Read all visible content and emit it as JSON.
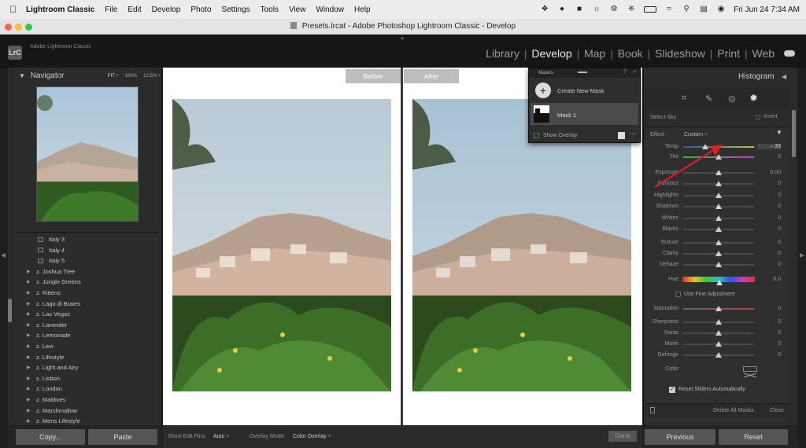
{
  "menubar": {
    "app": "Lightroom Classic",
    "items": [
      "File",
      "Edit",
      "Develop",
      "Photo",
      "Settings",
      "Tools",
      "View",
      "Window",
      "Help"
    ],
    "datetime": "Fri Jun 24  7:34 AM"
  },
  "window": {
    "title": "Presets.lrcat - Adobe Photoshop Lightroom Classic - Develop"
  },
  "identity": {
    "logo": "LrC",
    "line1": "Adobe Lightroom Classic"
  },
  "modules": [
    "Library",
    "Develop",
    "Map",
    "Book",
    "Slideshow",
    "Print",
    "Web"
  ],
  "active_module": "Develop",
  "navigator": {
    "title": "Navigator",
    "zoom": [
      "FIT ÷",
      "100%",
      "12.5% ÷"
    ]
  },
  "presets": [
    {
      "label": "Italy 3",
      "kind": "preset"
    },
    {
      "label": "Italy 4",
      "kind": "preset"
    },
    {
      "label": "Italy 5",
      "kind": "preset"
    },
    {
      "label": "z. Joshua Tree",
      "kind": "group"
    },
    {
      "label": "z. Jungle Greens",
      "kind": "group"
    },
    {
      "label": "z. Kittens",
      "kind": "group"
    },
    {
      "label": "z. Lago di Braies",
      "kind": "group"
    },
    {
      "label": "z. Las Vegas",
      "kind": "group"
    },
    {
      "label": "z. Lavender",
      "kind": "group"
    },
    {
      "label": "z. Lemonade",
      "kind": "group"
    },
    {
      "label": "z. Levi",
      "kind": "group"
    },
    {
      "label": "z. Lifestyle",
      "kind": "group"
    },
    {
      "label": "z. Light and Airy",
      "kind": "group"
    },
    {
      "label": "z. Lisbon",
      "kind": "group"
    },
    {
      "label": "z. London",
      "kind": "group"
    },
    {
      "label": "z. Maldives",
      "kind": "group"
    },
    {
      "label": "z. Marshmallow",
      "kind": "group"
    },
    {
      "label": "z. Mens Lifestyle",
      "kind": "group"
    }
  ],
  "left_buttons": {
    "copy": "Copy...",
    "paste": "Paste"
  },
  "compare": {
    "before": "Before",
    "after": "After"
  },
  "toolbar": {
    "edit_pins_label": "Show Edit Pins:",
    "edit_pins_value": "Auto ÷",
    "overlay_label": "Overlay Mode:",
    "overlay_value": "Color Overlay ÷",
    "done": "Done"
  },
  "masks": {
    "title": "Masks",
    "create": "Create New Mask",
    "mask1": "Mask 1",
    "show_overlay": "Show Overlay"
  },
  "right": {
    "histogram": "Histogram",
    "select_sky": "Select Sky",
    "invert": "Invert",
    "effect_label": "Effect :",
    "effect_value": "Custom ÷",
    "temp_label": "Temp",
    "temp_value": "– 33",
    "temp_pos": 0.31,
    "tint_label": "Tint",
    "tint_value": "0",
    "basic": [
      {
        "label": "Exposure",
        "value": "0.00"
      },
      {
        "label": "Contrast",
        "value": "0"
      },
      {
        "label": "Highlights",
        "value": "0"
      },
      {
        "label": "Shadows",
        "value": "0"
      },
      {
        "label": "Whites",
        "value": "0"
      },
      {
        "label": "Blacks",
        "value": "0"
      }
    ],
    "presence": [
      {
        "label": "Texture",
        "value": "0"
      },
      {
        "label": "Clarity",
        "value": "0"
      },
      {
        "label": "Dehaze",
        "value": "0"
      }
    ],
    "hue_label": "Hue",
    "hue_value": "0.0",
    "fine_adjust": "Use Fine Adjustment",
    "saturation_label": "Saturation",
    "saturation_value": "0",
    "detail": [
      {
        "label": "Sharpness",
        "value": "0"
      },
      {
        "label": "Noise",
        "value": "0"
      },
      {
        "label": "Moiré",
        "value": "0"
      },
      {
        "label": "Defringe",
        "value": "0"
      }
    ],
    "color_label": "Color",
    "reset_auto": "Reset Sliders Automatically",
    "delete_all": "Delete All Masks",
    "close": "Close",
    "previous": "Previous",
    "reset": "Reset"
  },
  "colors": {
    "annotation_arrow": "#e02020"
  }
}
